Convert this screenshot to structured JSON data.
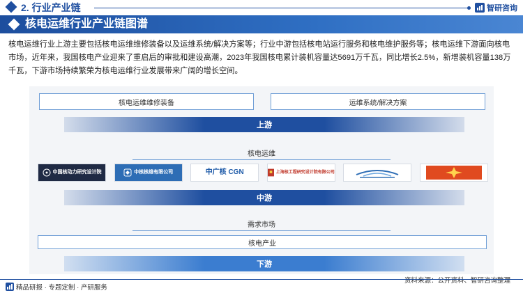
{
  "header": {
    "section_title": "2. 行业产业链",
    "brand_name": "智研咨询"
  },
  "banner": {
    "title": "核电运维行业产业链图谱"
  },
  "intro": {
    "text": "核电运维行业上游主要包括核电运维维修装备以及运维系统/解决方案等；行业中游包括核电站运行服务和核电维护服务等；核电运维下游面向核电市场，近年来，我国核电产业迎来了重启后的审批和建设高潮，2023年我国核电累计装机容量达5691万千瓦，同比增长2.5%，新增装机容量138万千瓦，下游市场持续繁荣为核电运维行业发展带来广阔的增长空间。"
  },
  "chain": {
    "upstream": {
      "items": [
        "核电运维维修装备",
        "运维系统/解决方案"
      ],
      "band_label": "上游"
    },
    "midstream": {
      "label": "核电运维",
      "logos": [
        {
          "name": "logo-cnpri",
          "text": "中国核动力研究设计院",
          "color": "#1f2a44"
        },
        {
          "name": "logo-cnnc-tech",
          "text": "中核核维有限公司",
          "color": "#ffffff"
        },
        {
          "name": "logo-cgn",
          "text": "中广核 CGN",
          "color": "#1e5aa8"
        },
        {
          "name": "logo-spic-sneri",
          "text": "上海核工程研究设计院有限公司",
          "color": "#c0392b"
        },
        {
          "name": "logo-blue-wing",
          "text": "",
          "color": "#2d6db5"
        },
        {
          "name": "logo-red-star",
          "text": "",
          "color": "#e04a1f"
        }
      ],
      "band_label": "中游"
    },
    "downstream": {
      "label": "需求市场",
      "items": [
        "核电产业"
      ],
      "band_label": "下游"
    }
  },
  "footer": {
    "left_text": "精品研报 · 专题定制 · 产研服务",
    "source_text": "资料来源：公开资料、智研咨询整理"
  },
  "colors": {
    "primary": "#1f4fa0",
    "accent": "#3b7dd0",
    "border": "#6f9ed6"
  }
}
